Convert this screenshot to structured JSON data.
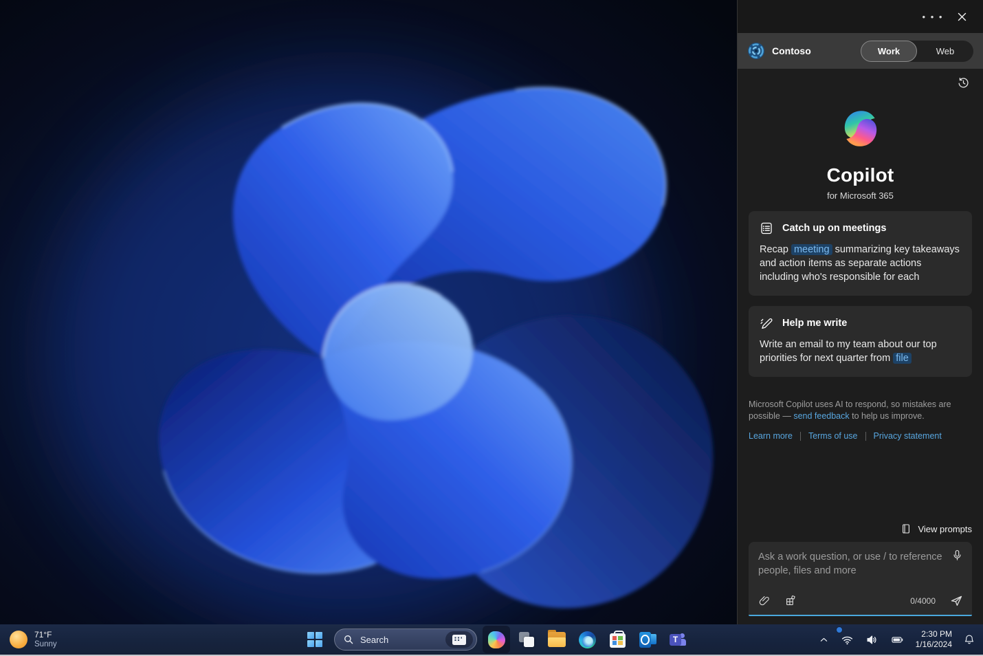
{
  "colors": {
    "accent_underline": "#4aa8dd",
    "link_blue": "#58a6df",
    "chip_bg": "#1d4266",
    "chip_text": "#7cbaef",
    "panel_bg": "#1d1d1d",
    "card_bg": "#2b2b2b",
    "taskbar_bg": "#16233d"
  },
  "icons": {
    "more": "• • •",
    "close": "✕"
  },
  "panel": {
    "brand": "Contoso",
    "toggle": {
      "work": "Work",
      "web": "Web",
      "selected": "Work"
    },
    "hero": {
      "title": "Copilot",
      "subtitle": "for Microsoft 365"
    },
    "cards": [
      {
        "title": "Catch up on meetings",
        "body_pre": "Recap ",
        "chip": "meeting",
        "body_post": " summarizing key takeaways and action items as separate actions including who's responsible for each"
      },
      {
        "title": "Help me write",
        "body_pre": "Write an email to my team about our top priorities for next quarter from ",
        "chip": "file",
        "body_post": ""
      }
    ],
    "disclaimer": {
      "pre": "Microsoft Copilot uses AI to respond, so mistakes are possible — ",
      "link": "send feedback",
      "post": " to help us improve."
    },
    "links": [
      "Learn more",
      "Terms of use",
      "Privacy statement"
    ],
    "view_prompts": "View prompts",
    "composer": {
      "placeholder": "Ask a work question, or use / to reference people, files and more",
      "counter": "0/4000"
    }
  },
  "taskbar": {
    "weather": {
      "temp": "71°F",
      "condition": "Sunny"
    },
    "search_placeholder": "Search",
    "teams_letter": "T",
    "clock": {
      "time": "2:30 PM",
      "date": "1/16/2024"
    }
  }
}
